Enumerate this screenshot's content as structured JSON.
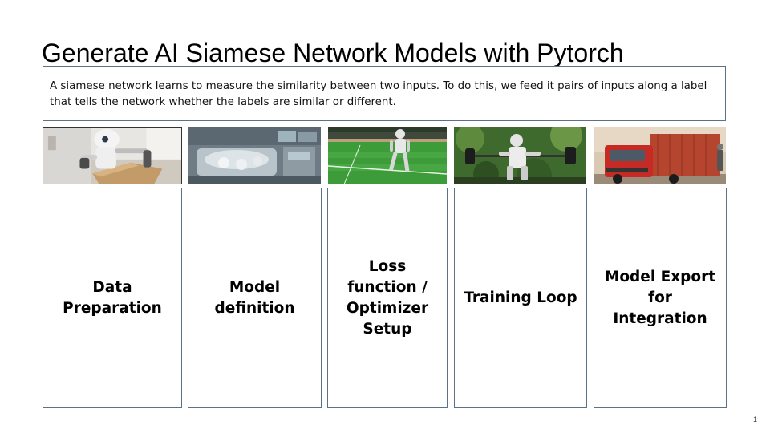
{
  "slide": {
    "title": "Generate AI Siamese Network Models with Pytorch",
    "description": "A siamese network learns to measure the similarity between two inputs. To do this, we feed it pairs of inputs along a label that tells the network whether the labels are similar or different.",
    "steps": [
      {
        "label": "Data\nPreparation",
        "image": "robot-packing-box-photo"
      },
      {
        "label": "Model\ndefinition",
        "image": "robotic-incubator-lab-photo"
      },
      {
        "label": "Loss\nfunction /\nOptimizer\nSetup",
        "image": "robot-on-soccer-field-photo"
      },
      {
        "label": "Training Loop",
        "image": "robot-lifting-barbell-photo"
      },
      {
        "label": "Model Export\nfor Integration",
        "image": "red-truck-with-robot-photo"
      }
    ],
    "page_number": "1"
  },
  "colors": {
    "border": "#5a7188",
    "text": "#000000",
    "background": "#ffffff"
  }
}
